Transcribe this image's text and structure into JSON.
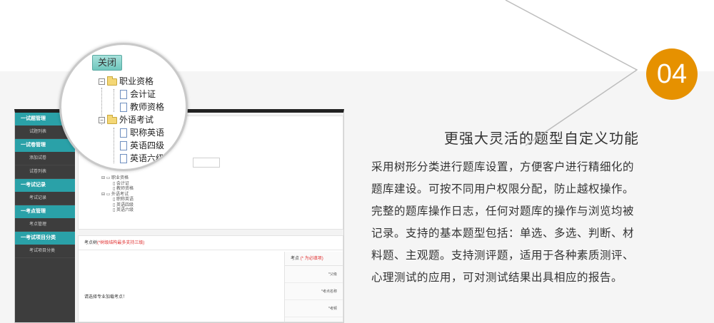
{
  "badge": {
    "number": "04",
    "color": "#e69100"
  },
  "feature": {
    "title": "更强大灵活的题型自定义功能",
    "lines": [
      "采用树形分类进行题库设置，方便客户进行精细化的",
      "题库建设。可按不同用户权限分配，防止越权操作。",
      "完整的题库操作日志，任何对题库的操作与浏览均被",
      "记录。支持的基本题型包括：单选、多选、判断、材",
      "料题、主观题。支持测评题，适用于各种素质测评、",
      "心理测试的应用，可对测试结果出具相应的报告。"
    ]
  },
  "magnifier": {
    "close_label": "关闭",
    "tree": {
      "cat1": "职业资格",
      "cat1_items": [
        "会计证",
        "教师资格"
      ],
      "cat2": "外语考试",
      "cat2_items": [
        "职称英语",
        "英语四级",
        "英语六级"
      ]
    }
  },
  "app": {
    "sidebar": [
      {
        "group": "一试题管理",
        "items": [
          "试题列表"
        ]
      },
      {
        "group": "一试卷管理",
        "items": [
          "添加试卷",
          "试卷列表"
        ]
      },
      {
        "group": "一考试记录",
        "items": [
          "考试记录"
        ]
      },
      {
        "group": "一考点管理",
        "items": [
          "考点管理"
        ]
      },
      {
        "group": "一考试项目分类",
        "items": [
          "考试项目分类"
        ]
      }
    ],
    "mini_tree": {
      "cat1": "职业资格",
      "cat1_items": [
        "会计证",
        "教师资格"
      ],
      "cat2": "外语考试",
      "cat2_items": [
        "职称英语",
        "英语四级",
        "英语六级"
      ]
    },
    "panel_title": "考点树",
    "panel_title_note": "(*树级结构最多支持三级)",
    "left_hint": "请选择专业加载考点！",
    "right_head": "考点",
    "right_head_note": "(* 为必填项)",
    "right_rows": [
      "*父级",
      "*考点名称",
      "*考频"
    ]
  }
}
